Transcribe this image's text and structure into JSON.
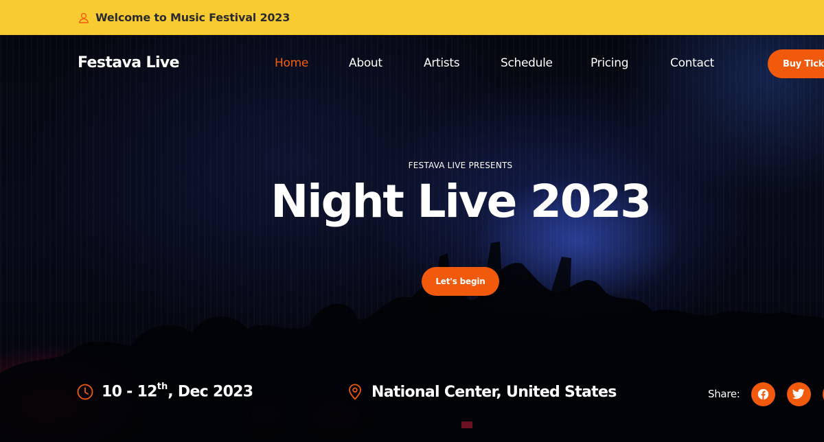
{
  "topbar": {
    "welcome_text": "Welcome to Music Festival 2023",
    "icon": "user-icon"
  },
  "navbar": {
    "brand": "Festava Live",
    "links": [
      {
        "label": "Home",
        "active": true
      },
      {
        "label": "About",
        "active": false
      },
      {
        "label": "Artists",
        "active": false
      },
      {
        "label": "Schedule",
        "active": false
      },
      {
        "label": "Pricing",
        "active": false
      },
      {
        "label": "Contact",
        "active": false
      }
    ],
    "cta_label": "Buy Ticket"
  },
  "hero": {
    "eyebrow": "FESTAVA LIVE PRESENTS",
    "title": "Night Live 2023",
    "button_label": "Let's begin"
  },
  "event_info": {
    "date_range": "10 - 12",
    "date_suffix": "th",
    "date_month_year": ", Dec 2023",
    "date_icon": "clock-icon",
    "location": "National Center, United States",
    "location_icon": "map-pin-icon"
  },
  "share": {
    "label": "Share:",
    "networks": [
      "facebook-icon",
      "twitter-icon",
      "instagram-icon"
    ]
  },
  "colors": {
    "topbar_bg": "#f9cb33",
    "accent": "#f15a0c",
    "active_link": "#f3600f",
    "hero_bg": "#05060c",
    "text_light": "#ffffff"
  }
}
